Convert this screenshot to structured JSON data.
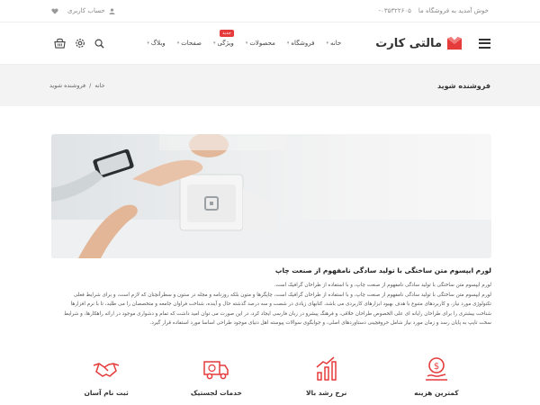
{
  "topbar": {
    "welcome": "خوش آمدید به فروشگاه ما",
    "phone": "۰۳۵۳۲۲۶۰۵-",
    "account": "حساب کاربری"
  },
  "header": {
    "logo_text": "مالتی کارت",
    "nav": [
      {
        "label": "خانه",
        "chev": "▾"
      },
      {
        "label": "فروشگاه",
        "chev": "▾"
      },
      {
        "label": "محصولات",
        "chev": "▾"
      },
      {
        "label": "ویژگی",
        "chev": "▾",
        "badge": "جدید"
      },
      {
        "label": "صفحات",
        "chev": "▾"
      },
      {
        "label": "وبلاگ",
        "chev": "▾"
      }
    ],
    "icons": [
      "cart-icon",
      "settings-icon",
      "search-icon",
      "menu-icon"
    ]
  },
  "page": {
    "title": "فروشنده شوید",
    "breadcrumb": {
      "home": "خانه",
      "sep": "/",
      "current": "فروشنده شوید"
    }
  },
  "article": {
    "heading": "لورم ایپسوم متن ساختگی با تولید سادگی نامفهوم از صنعت چاپ",
    "lines": [
      "لورم ایپسوم متن ساختگی با تولید سادگی نامفهوم از صنعت چاپ، و با استفاده از طراحان گرافیک است.",
      "لورم ایپسوم متن ساختگی با تولید سادگی نامفهوم از صنعت چاپ، و با استفاده از طراحان گرافیک است، چاپگرها و متون بلکه روزنامه و مجله در ستون و سطرآنچنان که لازم است، و برای شرایط فعلی",
      "تکنولوژی مورد نیاز، و کاربردهای متنوع با هدف بهبود ابزارهای کاربردی می باشد، کتابهای زیادی در شصت و سه درصد گذشته حال و آینده، شناخت فراوان جامعه و متخصصان را می طلبد، تا با نرم افزارها",
      "شناخت بیشتری را برای طراحان رایانه ای علی الخصوص طراحان خلاقی، و فرهنگ پیشرو در زبان فارسی ایجاد کرد، در این صورت می توان امید داشت که تمام و دشواری موجود در ارائه راهکارها، و شرایط",
      "سخت تایپ به پایان رسد و زمان مورد نیاز شامل حروفچینی دستاوردهای اصلی، و جوابگوی سوالات پیوسته اهل دنیای موجود طراحی اساسا مورد استفاده قرار گیرد."
    ]
  },
  "features": [
    {
      "icon": "coins-icon",
      "label": "کمترین هزینه"
    },
    {
      "icon": "growth-chart-icon",
      "label": "نرخ رشد بالا"
    },
    {
      "icon": "delivery-truck-icon",
      "label": "خدمات لجستیک"
    },
    {
      "icon": "handshake-icon",
      "label": "ثبت نام آسان"
    }
  ],
  "colors": {
    "accent": "#e53b3b",
    "band": "#f3f3f3",
    "text": "#333333"
  }
}
